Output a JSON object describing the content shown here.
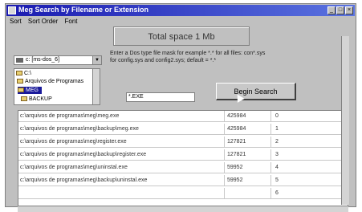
{
  "window": {
    "title": "Meg Search by Filename or Extension"
  },
  "menu": [
    "Sort",
    "Sort Order",
    "Font"
  ],
  "total_space": "Total space 1 Mb",
  "help_text": [
    "Enter a Dos type file mask for example *.* for all files: con*.sys",
    "for config.sys and config2.sys; default = *.*"
  ],
  "drive": {
    "label": "c: [ms-dos_6]"
  },
  "folders": [
    {
      "label": "C:\\"
    },
    {
      "label": "Arquivos de Programas"
    },
    {
      "label": "MEG"
    },
    {
      "label": "BACKUP"
    }
  ],
  "mask_input": {
    "value": "*.EXE"
  },
  "begin_button": {
    "label": "Begin Search"
  },
  "results": [
    {
      "path": "c:\\arquivos de programas\\meg\\meg.exe",
      "size": "425984",
      "index": "0"
    },
    {
      "path": "c:\\arquivos de programas\\meg\\backup\\meg.exe",
      "size": "425984",
      "index": "1"
    },
    {
      "path": "c:\\arquivos de programas\\meg\\register.exe",
      "size": "127821",
      "index": "2"
    },
    {
      "path": "c:\\arquivos de programas\\meg\\backup\\register.exe",
      "size": "127821",
      "index": "3"
    },
    {
      "path": "c:\\arquivos de programas\\meg\\uninstal.exe",
      "size": "59952",
      "index": "4"
    },
    {
      "path": "c:\\arquivos de programas\\meg\\backup\\uninstal.exe",
      "size": "59952",
      "index": "5"
    },
    {
      "path": "",
      "size": "",
      "index": "6"
    }
  ]
}
